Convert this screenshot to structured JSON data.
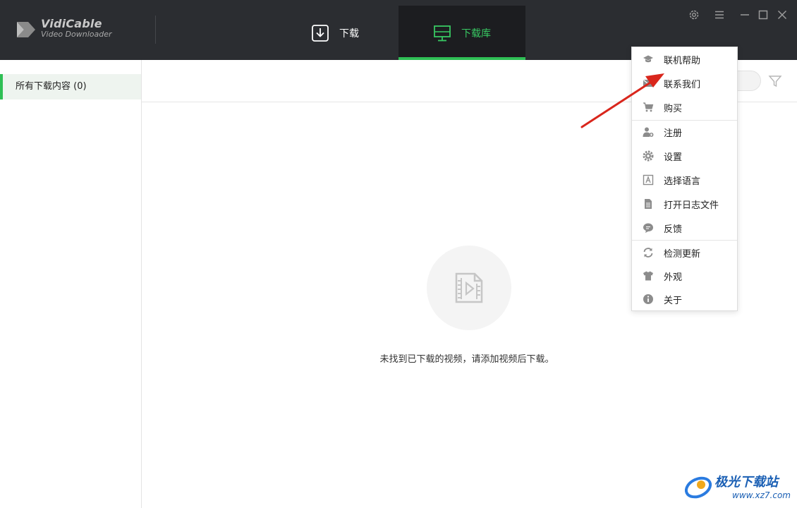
{
  "app": {
    "logo_name": "VidiCable",
    "logo_sub": "Video Downloader"
  },
  "nav": {
    "tabs": [
      {
        "label": "下载",
        "icon": "download-icon"
      },
      {
        "label": "下载库",
        "icon": "library-monitor-icon",
        "active": true
      }
    ]
  },
  "window_controls": [
    "gear-icon",
    "menu-icon",
    "minimize-icon",
    "maximize-icon",
    "close-icon"
  ],
  "sidebar": {
    "items": [
      {
        "label": "所有下载内容 (0)",
        "active": true
      }
    ]
  },
  "main": {
    "empty_message": "未找到已下载的视频，请添加视频后下载。"
  },
  "menu": {
    "groups": [
      [
        {
          "label": "联机帮助",
          "icon": "graduation-cap-icon"
        },
        {
          "label": "联系我们",
          "icon": "mail-icon"
        },
        {
          "label": "购买",
          "icon": "cart-icon"
        }
      ],
      [
        {
          "label": "注册",
          "icon": "user-add-icon"
        },
        {
          "label": "设置",
          "icon": "gear-icon"
        },
        {
          "label": "选择语言",
          "icon": "language-icon"
        },
        {
          "label": "打开日志文件",
          "icon": "document-icon"
        },
        {
          "label": "反馈",
          "icon": "chat-bubble-icon"
        }
      ],
      [
        {
          "label": "检测更新",
          "icon": "refresh-icon"
        },
        {
          "label": "外观",
          "icon": "tshirt-icon"
        },
        {
          "label": "关于",
          "icon": "info-icon"
        }
      ]
    ]
  },
  "watermark": {
    "text": "极光下载站",
    "url": "www.xz7.com"
  },
  "colors": {
    "titlebar": "#2b2d31",
    "accent": "#2fbf55",
    "arrow": "#d9261c"
  }
}
